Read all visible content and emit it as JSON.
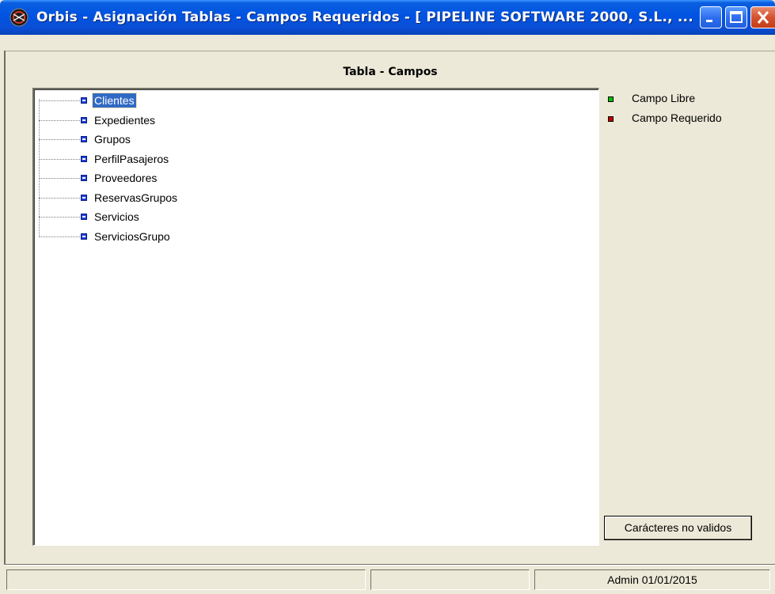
{
  "window": {
    "title": "Orbis - Asignación Tablas - Campos Requeridos - [ PIPELINE SOFTWARE 2000, S.L., ...",
    "app_icon": "orbis-app-icon",
    "controls": [
      "minimize-icon",
      "maximize-icon",
      "close-icon"
    ]
  },
  "panel": {
    "title": "Tabla - Campos"
  },
  "tree": {
    "items": [
      {
        "label": "Clientes",
        "selected": true
      },
      {
        "label": "Expedientes",
        "selected": false
      },
      {
        "label": "Grupos",
        "selected": false
      },
      {
        "label": "PerfilPasajeros",
        "selected": false
      },
      {
        "label": "Proveedores",
        "selected": false
      },
      {
        "label": "ReservasGrupos",
        "selected": false
      },
      {
        "label": "Servicios",
        "selected": false
      },
      {
        "label": "ServiciosGrupo",
        "selected": false
      }
    ]
  },
  "legend": {
    "items": [
      {
        "label": "Campo Libre",
        "color": "#00c000"
      },
      {
        "label": "Campo Requerido",
        "color": "#c00000"
      }
    ]
  },
  "buttons": {
    "invalid_chars": "Carácteres no validos"
  },
  "status_bar": {
    "panels": [
      "",
      "",
      "Admin 01/01/2015"
    ]
  }
}
